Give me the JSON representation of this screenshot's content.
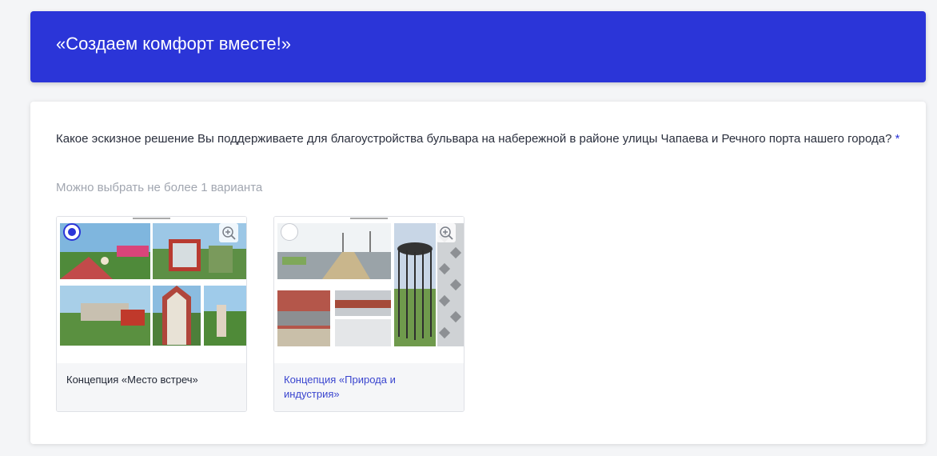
{
  "header": {
    "title": "«Создаем комфорт вместе!»"
  },
  "question": {
    "text": "Какое эскизное решение Вы поддерживаете для благоустройства бульвара на набережной в районе улицы Чапаева и Речного порта нашего города?",
    "required_mark": "*",
    "hint": "Можно выбрать не более 1 варианта"
  },
  "options": [
    {
      "label": "Концепция «Место встреч»",
      "selected": true,
      "icon": "zoom-in-icon"
    },
    {
      "label": "Концепция «Природа и индустрия»",
      "selected": false,
      "icon": "zoom-in-icon"
    }
  ],
  "colors": {
    "accent": "#2b35d8",
    "link": "#3a45cf",
    "hint": "#a1a6b0"
  }
}
